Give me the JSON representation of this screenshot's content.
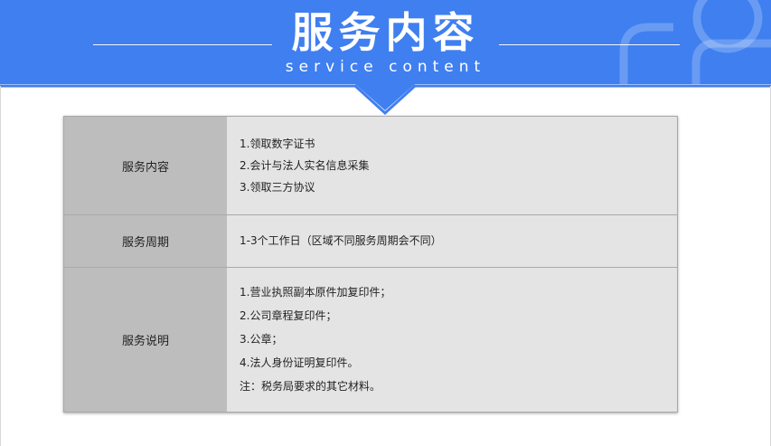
{
  "header": {
    "title": "服务内容",
    "subtitle": "service content"
  },
  "colors": {
    "banner": "#3f7ff0",
    "label_cell": "#bdbdbd",
    "value_cell": "#e4e4e4"
  },
  "rows": [
    {
      "label": "服务内容",
      "lines": [
        "1.领取数字证书",
        "2.会计与法人实名信息采集",
        "3.领取三方协议"
      ]
    },
    {
      "label": "服务周期",
      "lines": [
        "1-3个工作日（区域不同服务周期会不同）"
      ]
    },
    {
      "label": "服务说明",
      "lines": [
        "1.营业执照副本原件加复印件；",
        "2.公司章程复印件；",
        "3.公章；",
        "4.法人身份证明复印件。",
        "注：税务局要求的其它材料。"
      ]
    }
  ]
}
